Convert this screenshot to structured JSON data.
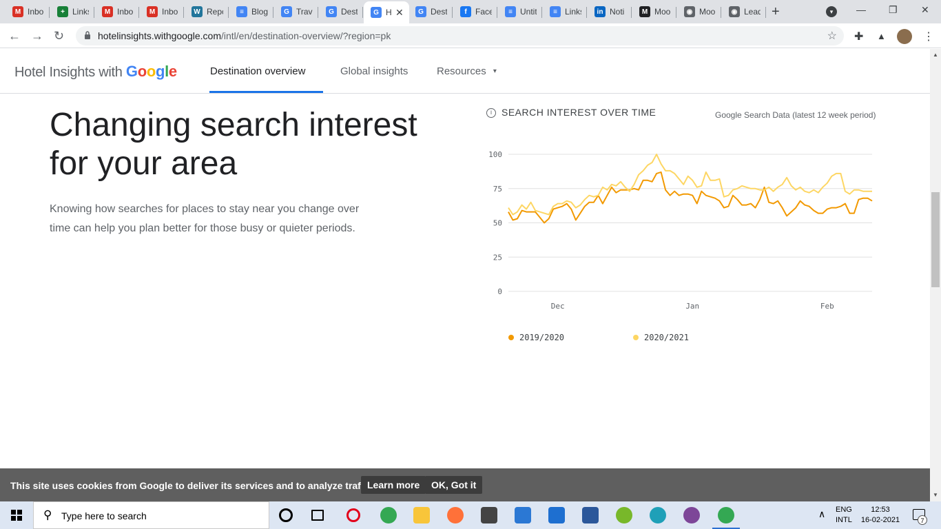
{
  "browser": {
    "tabs": [
      {
        "label": "Inbo",
        "icon": "gmail-icon",
        "color": "#d93025",
        "glyph": "M"
      },
      {
        "label": "Links",
        "icon": "sheets-icon",
        "color": "#188038",
        "glyph": "+"
      },
      {
        "label": "Inbo",
        "icon": "gmail-icon",
        "color": "#d93025",
        "glyph": "M"
      },
      {
        "label": "Inbo",
        "icon": "gmail-icon",
        "color": "#d93025",
        "glyph": "M"
      },
      {
        "label": "Repc",
        "icon": "wordpress-icon",
        "color": "#21759b",
        "glyph": "W"
      },
      {
        "label": "Blog",
        "icon": "docs-icon",
        "color": "#4285f4",
        "glyph": "≡"
      },
      {
        "label": "Trave",
        "icon": "google-icon",
        "color": "#4285f4",
        "glyph": "G"
      },
      {
        "label": "Dest",
        "icon": "google-icon",
        "color": "#4285f4",
        "glyph": "G"
      },
      {
        "label": "H",
        "icon": "google-icon",
        "color": "#4285f4",
        "glyph": "G",
        "active": true
      },
      {
        "label": "Dest",
        "icon": "google-icon",
        "color": "#4285f4",
        "glyph": "G"
      },
      {
        "label": "Face",
        "icon": "facebook-icon",
        "color": "#1877f2",
        "glyph": "f"
      },
      {
        "label": "Untit",
        "icon": "docs-icon",
        "color": "#4285f4",
        "glyph": "≡"
      },
      {
        "label": "Links",
        "icon": "docs-icon",
        "color": "#4285f4",
        "glyph": "≡"
      },
      {
        "label": "Noti",
        "icon": "linkedin-icon",
        "color": "#0a66c2",
        "glyph": "in"
      },
      {
        "label": "Moo",
        "icon": "medium-icon",
        "color": "#202124",
        "glyph": "M"
      },
      {
        "label": "Moo",
        "icon": "globe-icon",
        "color": "#5f6368",
        "glyph": "◉"
      },
      {
        "label": "Lead",
        "icon": "globe-icon",
        "color": "#5f6368",
        "glyph": "◉"
      }
    ],
    "close_glyph": "✕",
    "new_tab_glyph": "+",
    "tab_search_glyph": "▾",
    "minimize_glyph": "—",
    "restore_glyph": "❐",
    "window_close_glyph": "✕",
    "back_glyph": "←",
    "forward_glyph": "→",
    "reload_glyph": "↻",
    "star_glyph": "☆",
    "extensions_glyph": "✚",
    "profile_glyph": "▲",
    "menu_glyph": "⋮",
    "url_host": "hotelinsights.withgoogle.com",
    "url_path": "/intl/en/destination-overview/?region=pk"
  },
  "site": {
    "brand_text": "Hotel Insights with",
    "brand_google": [
      "G",
      "o",
      "o",
      "g",
      "l",
      "e"
    ],
    "brand_colors": [
      "#4285f4",
      "#ea4335",
      "#fbbc05",
      "#4285f4",
      "#34a853",
      "#ea4335"
    ],
    "nav": [
      {
        "label": "Destination overview",
        "active": true
      },
      {
        "label": "Global insights"
      },
      {
        "label": "Resources",
        "caret": "▾"
      }
    ]
  },
  "content": {
    "headline": "Changing search interest for your area",
    "description": "Knowing how searches for places to stay near you change over time can help you plan better for those busy or quieter periods.",
    "chart_title": "SEARCH INTEREST OVER TIME",
    "info_glyph": "i",
    "chart_source": "Google Search Data (latest 12 week period)"
  },
  "chart_data": {
    "type": "line",
    "title": "SEARCH INTEREST OVER TIME",
    "ylim": [
      0,
      100
    ],
    "yticks": [
      0,
      25,
      50,
      75,
      100
    ],
    "xtick_labels": [
      {
        "label": "Dec",
        "day": 11
      },
      {
        "label": "Jan",
        "day": 41
      },
      {
        "label": "Feb",
        "day": 71
      }
    ],
    "series": [
      {
        "name": "2019/2020",
        "color": "#f29900",
        "values": [
          58,
          52,
          53,
          59,
          58,
          58,
          58,
          54,
          50,
          53,
          60,
          61,
          62,
          64,
          60,
          52,
          57,
          62,
          65,
          65,
          70,
          64,
          70,
          76,
          72,
          74,
          74,
          74,
          75,
          74,
          81,
          81,
          80,
          86,
          87,
          74,
          70,
          73,
          70,
          71,
          71,
          70,
          64,
          73,
          70,
          69,
          68,
          66,
          61,
          62,
          70,
          67,
          63,
          63,
          64,
          61,
          67,
          76,
          65,
          64,
          66,
          61,
          55,
          58,
          61,
          66,
          63,
          62,
          59,
          57,
          57,
          60,
          61,
          61,
          62,
          64,
          57,
          57,
          67,
          68,
          68,
          66
        ]
      },
      {
        "name": "2020/2021",
        "color": "#fdd663",
        "values": [
          61,
          56,
          58,
          63,
          60,
          65,
          59,
          58,
          57,
          56,
          62,
          64,
          64,
          66,
          65,
          61,
          63,
          67,
          70,
          69,
          70,
          76,
          74,
          78,
          77,
          80,
          76,
          73,
          78,
          85,
          88,
          92,
          94,
          100,
          93,
          88,
          88,
          86,
          82,
          78,
          84,
          81,
          76,
          77,
          87,
          81,
          81,
          82,
          69,
          70,
          74,
          75,
          77,
          76,
          75,
          75,
          74,
          74,
          76,
          73,
          76,
          78,
          83,
          77,
          74,
          76,
          73,
          72,
          74,
          72,
          76,
          79,
          84,
          86,
          86,
          73,
          71,
          74,
          74,
          73,
          73,
          73
        ]
      }
    ]
  },
  "cookie_banner": {
    "text": "This site uses cookies from Google to deliver its services and to analyze traffic.",
    "learn_more": "Learn more",
    "ok": "OK, Got it"
  },
  "taskbar": {
    "search_placeholder": "Type here to search",
    "search_glyph": "⚲",
    "apps": [
      {
        "name": "cortana-icon",
        "color": "#000000",
        "shape": "ring"
      },
      {
        "name": "task-view-icon",
        "color": "#000000",
        "shape": "taskview"
      },
      {
        "name": "opera-icon",
        "color": "#e2001a",
        "shape": "ring"
      },
      {
        "name": "chrome-icon",
        "color": "#34a853",
        "shape": "circle"
      },
      {
        "name": "file-explorer-icon",
        "color": "#f8c53a",
        "shape": "square"
      },
      {
        "name": "firefox-icon",
        "color": "#ff7139",
        "shape": "circle"
      },
      {
        "name": "store-icon",
        "color": "#444444",
        "shape": "square"
      },
      {
        "name": "mail-icon",
        "color": "#2b78d4",
        "shape": "square"
      },
      {
        "name": "movies-icon",
        "color": "#1e6fd0",
        "shape": "square"
      },
      {
        "name": "word-icon",
        "color": "#2b579a",
        "shape": "square"
      },
      {
        "name": "utorrent-icon",
        "color": "#78b82a",
        "shape": "circle"
      },
      {
        "name": "edge-icon",
        "color": "#1fa0b8",
        "shape": "circle"
      },
      {
        "name": "tor-icon",
        "color": "#7d4698",
        "shape": "circle"
      },
      {
        "name": "chrome-profile-icon",
        "color": "#34a853",
        "shape": "circle",
        "running": true
      }
    ],
    "tray_up_glyph": "∧",
    "lang_line1": "ENG",
    "lang_line2": "INTL",
    "time": "12:53",
    "date": "16-02-2021",
    "notification_count": "7"
  }
}
